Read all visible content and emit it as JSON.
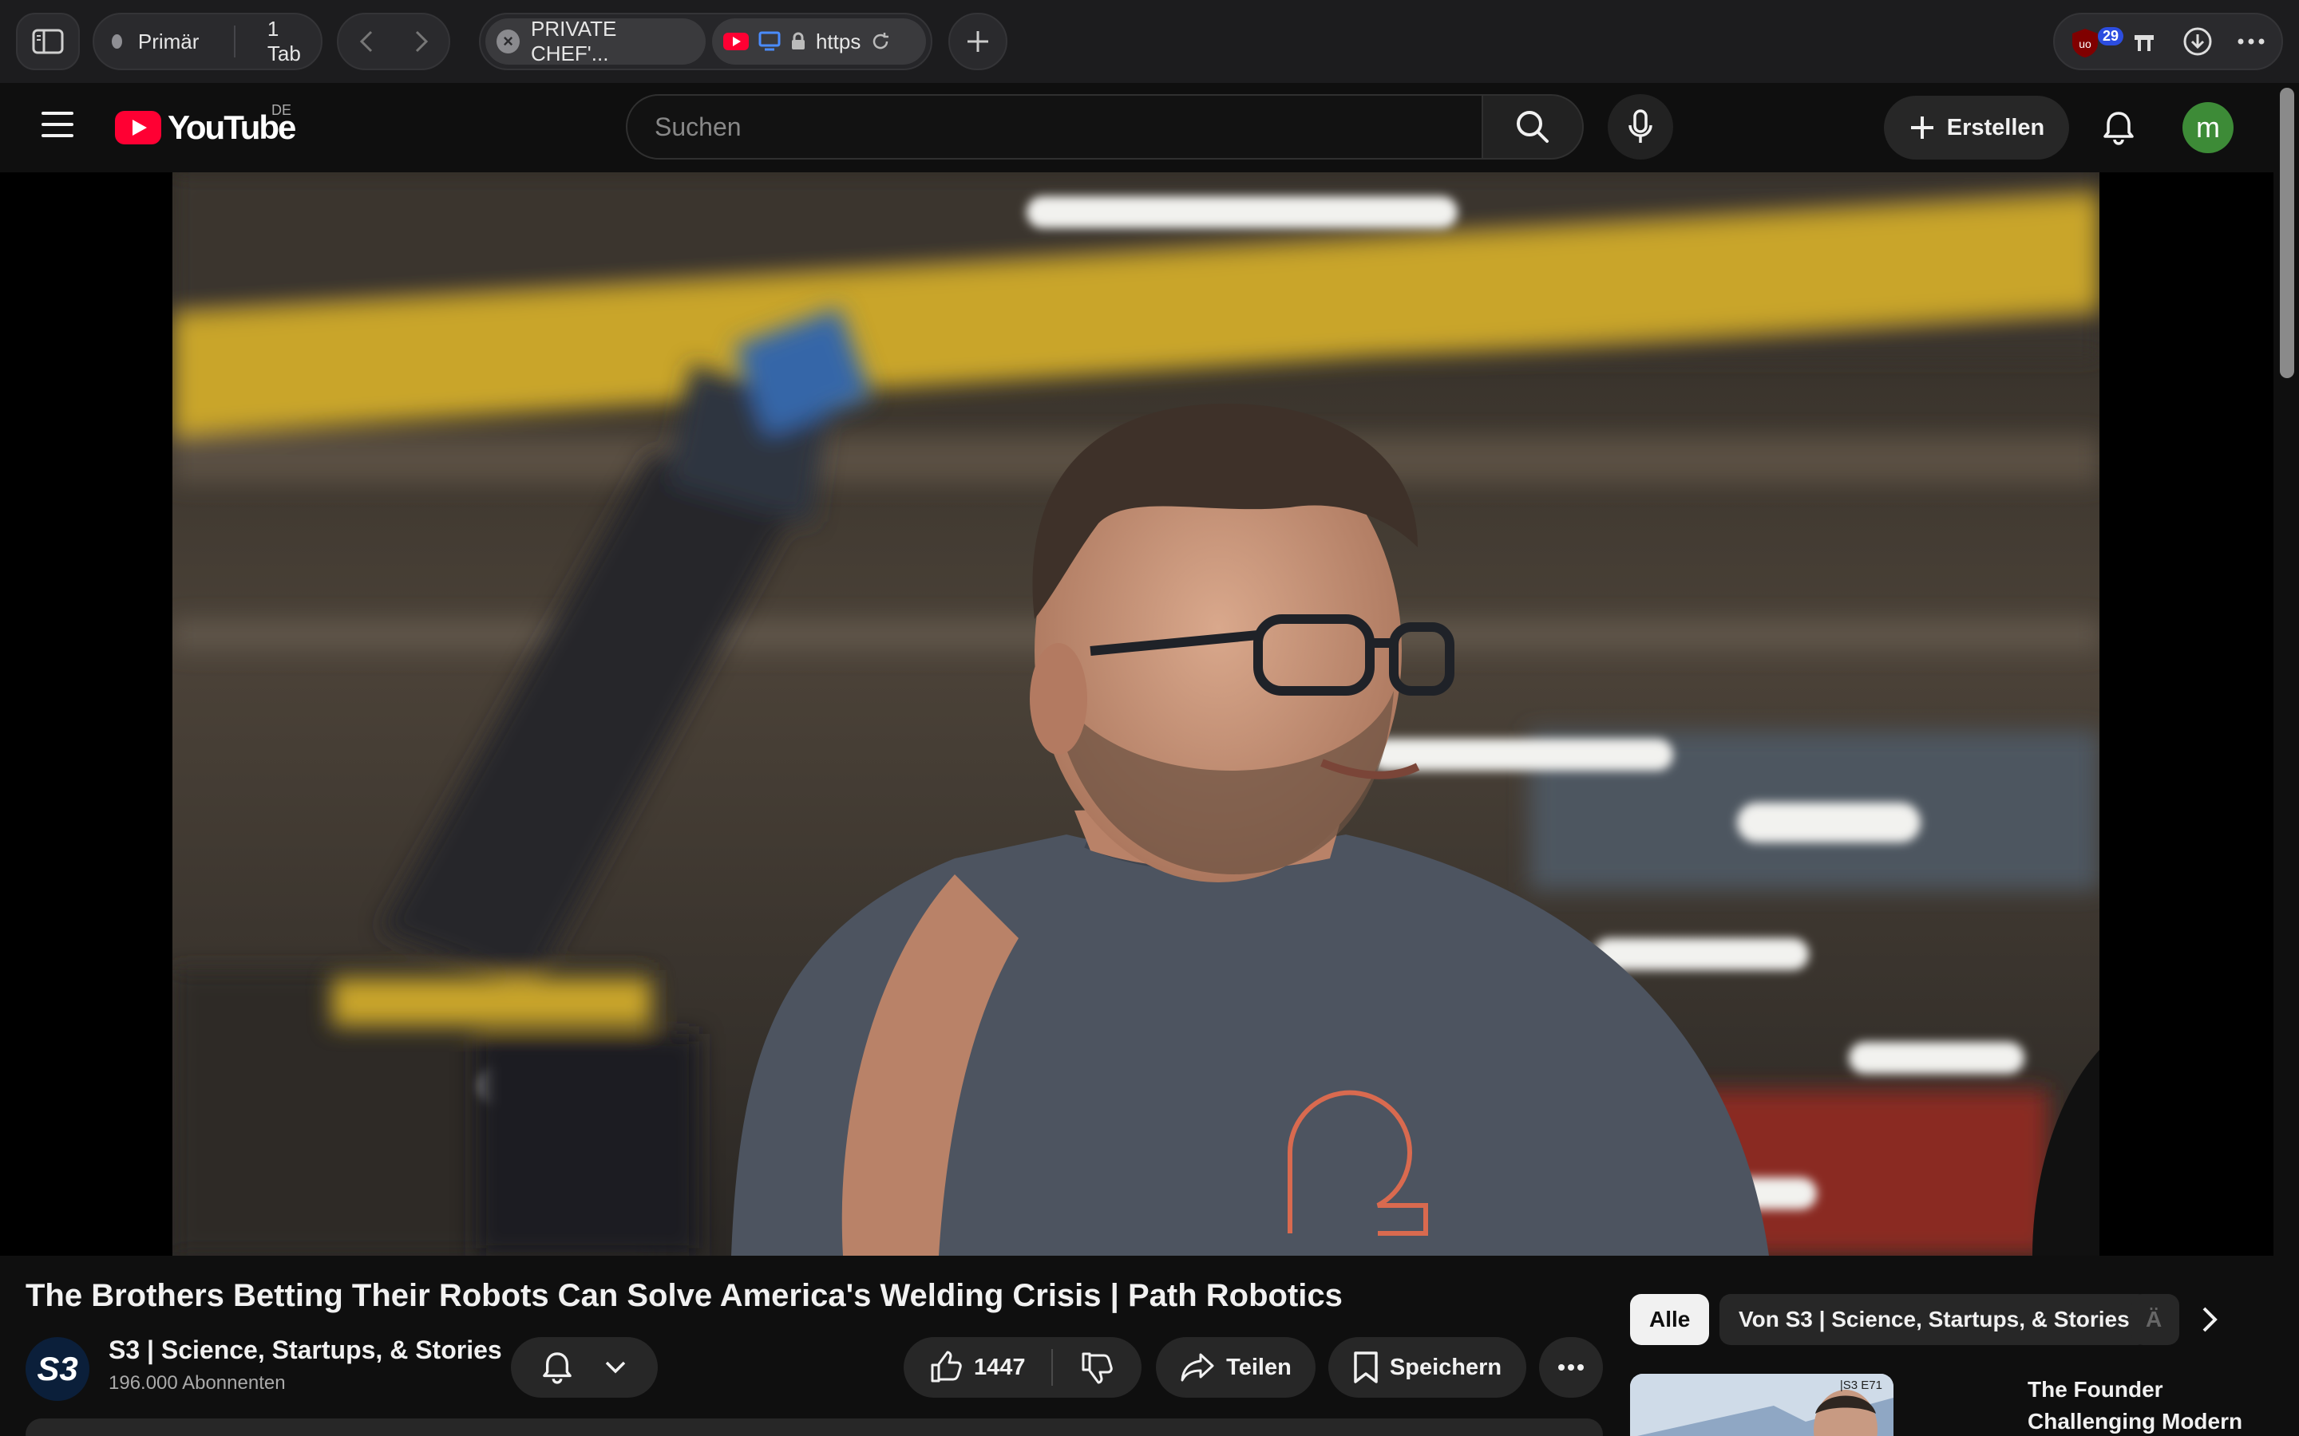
{
  "browser": {
    "profile": "Primär",
    "tab_count": "1 Tab",
    "tabs": [
      {
        "title": "PRIVATE CHEF'..."
      },
      {
        "url": "https"
      }
    ],
    "extension_badge": "29"
  },
  "youtube": {
    "logo_text": "YouTube",
    "country_code": "DE",
    "search_placeholder": "Suchen",
    "create_label": "Erstellen",
    "avatar_letter": "m"
  },
  "video": {
    "title": "The Brothers Betting Their Robots Can Solve America's Welding Crisis | Path Robotics",
    "channel": {
      "name": "S3 | Science, Startups, & Stories",
      "subscribers": "196.000 Abonnenten",
      "avatar_text": "S3"
    },
    "likes": "1447",
    "share_label": "Teilen",
    "save_label": "Speichern"
  },
  "sidebar": {
    "chips": [
      {
        "label": "Alle"
      },
      {
        "label": "Von S3 | Science, Startups, & Stories"
      },
      {
        "label": "Ä"
      }
    ],
    "recommended": [
      {
        "title": "The Founder Challenging Modern",
        "badge": "|S3 E71"
      }
    ]
  },
  "colors": {
    "youtube_red": "#ff0033",
    "background": "#0f0f0f",
    "avatar_green": "#3d8b37"
  }
}
